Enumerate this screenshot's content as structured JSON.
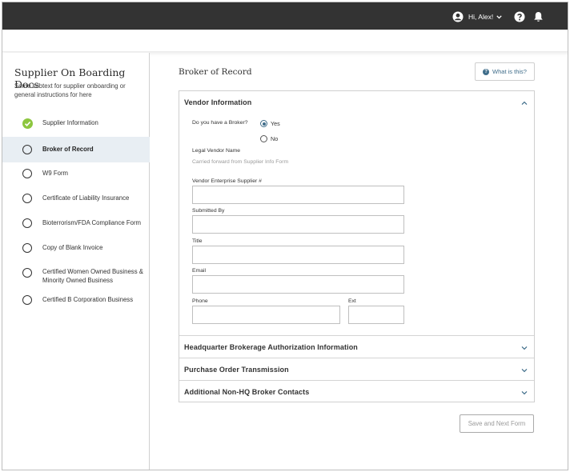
{
  "header": {
    "greeting": "Hi, Alex!",
    "icons": [
      "user-avatar-icon",
      "chevron-down-icon",
      "help-icon",
      "bell-icon"
    ]
  },
  "sidebar": {
    "title": "Supplier On Boarding Docs",
    "subtitle": "Some subtext for supplier onboarding or general instructions for here",
    "steps": [
      {
        "label": "Supplier Information",
        "status": "complete"
      },
      {
        "label": "Broker of Record",
        "status": "active"
      },
      {
        "label": "W9 Form",
        "status": "pending"
      },
      {
        "label": "Certificate of Liability Insurance",
        "status": "pending"
      },
      {
        "label": "Bioterrorism/FDA Compliance Form",
        "status": "pending"
      },
      {
        "label": "Copy of Blank Invoice",
        "status": "pending"
      },
      {
        "label": "Certified Women Owned Business & Minority Owned Business",
        "status": "pending"
      },
      {
        "label": "Certified B Corporation Business",
        "status": "pending"
      }
    ]
  },
  "main": {
    "title": "Broker of Record",
    "help_button": "What is this?",
    "save_button": "Save and Next Form"
  },
  "vendor_section": {
    "title": "Vendor Information",
    "expanded": true,
    "broker_question": "Do you have a Broker?",
    "broker_options": [
      {
        "label": "Yes",
        "selected": true
      },
      {
        "label": "No",
        "selected": false
      }
    ],
    "legal_name_label": "Legal Vendor Name",
    "legal_name_value": "Carried forward from Supplier Info Form",
    "fields": {
      "supplier_number": {
        "label": "Vendor Enterprise Supplier #",
        "value": ""
      },
      "submitted_by": {
        "label": "Submitted By",
        "value": ""
      },
      "title": {
        "label": "Title",
        "value": ""
      },
      "email": {
        "label": "Email",
        "value": ""
      },
      "phone": {
        "label": "Phone",
        "value": ""
      },
      "ext": {
        "label": "Ext",
        "value": ""
      }
    }
  },
  "collapsed_sections": [
    {
      "title": "Headquarter Brokerage Authorization Information"
    },
    {
      "title": "Purchase Order Transmission"
    },
    {
      "title": "Additional Non-HQ Broker Contacts"
    }
  ],
  "colors": {
    "topbar": "#333333",
    "accent": "#3f6d8a",
    "complete": "#8dc63f",
    "active_row": "#e8eef3"
  }
}
